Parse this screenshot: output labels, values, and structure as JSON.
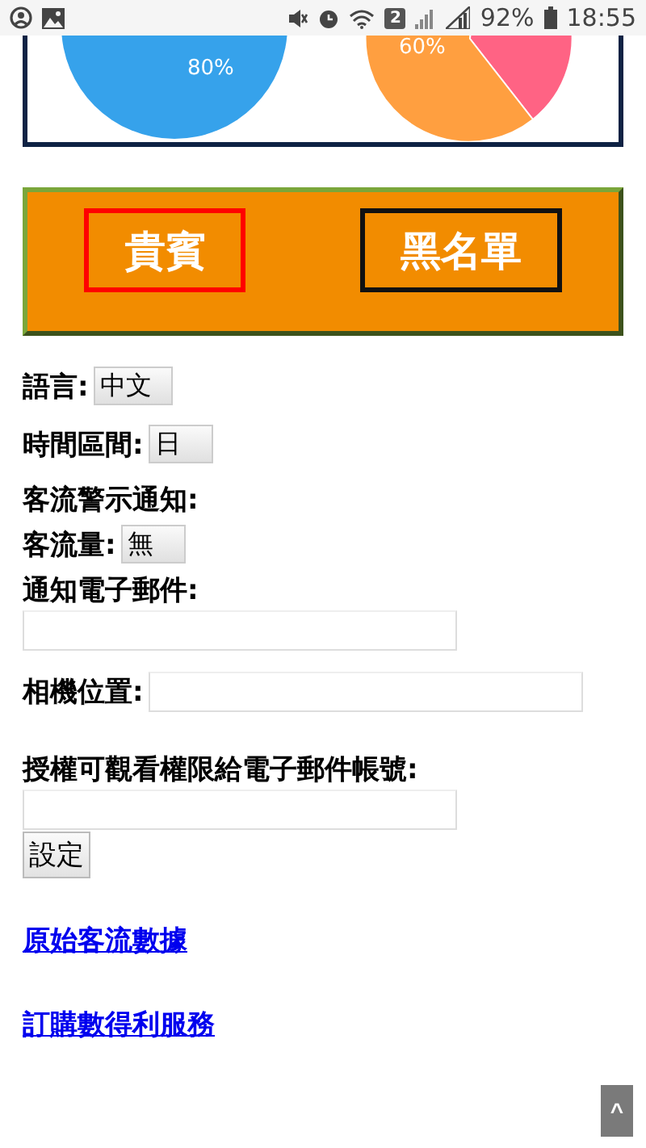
{
  "status_bar": {
    "sim_badge": "2",
    "battery": "92%",
    "time": "18:55"
  },
  "charts": [
    {
      "label": "80%"
    },
    {
      "label": "60%"
    }
  ],
  "tabs": [
    {
      "label": "貴賓",
      "selected": true
    },
    {
      "label": "黑名單",
      "selected": false
    }
  ],
  "form": [
    {
      "kind": "select",
      "label": "語言:",
      "value": "中文"
    },
    {
      "kind": "select",
      "label": "時間區間:",
      "value": "日"
    },
    {
      "kind": "heading",
      "label": "客流警示通知:"
    },
    {
      "kind": "select",
      "label": "客流量:",
      "value": "無"
    },
    {
      "kind": "block-input",
      "label": "通知電子郵件:"
    },
    {
      "kind": "inline-input",
      "label": "相機位置:"
    },
    {
      "kind": "block-input",
      "label": "授權可觀看權限給電子郵件帳號:"
    }
  ],
  "submit": "設定",
  "links": [
    "原始客流數據",
    "訂購數得利服務"
  ],
  "scroll_top": "^"
}
